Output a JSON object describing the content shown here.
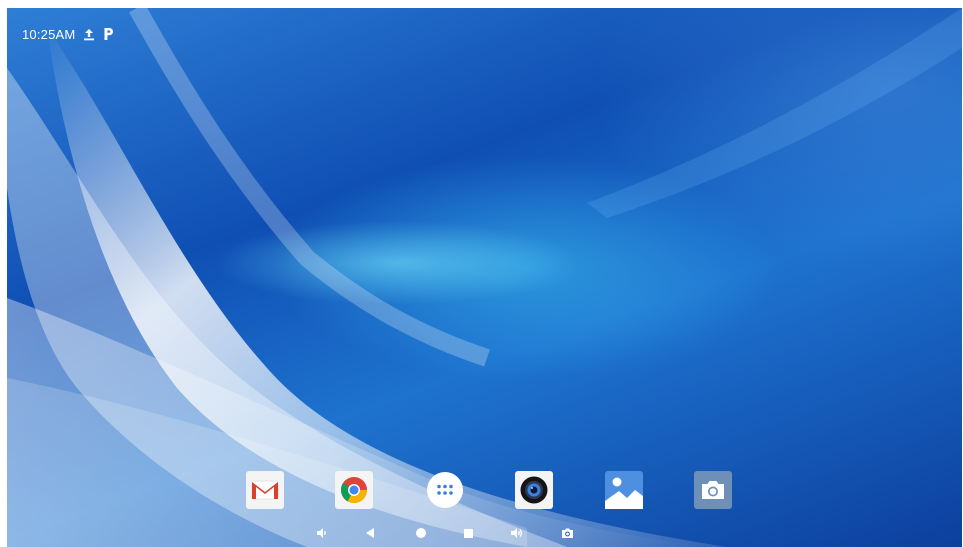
{
  "status_bar": {
    "time": "10:25AM",
    "icons": [
      "upload-icon",
      "parking-p-icon"
    ]
  },
  "dock": {
    "apps": [
      {
        "icon": "gmail-icon"
      },
      {
        "icon": "chrome-icon"
      },
      {
        "icon": "app-drawer-icon"
      },
      {
        "icon": "camera-lens-app-icon"
      },
      {
        "icon": "gallery-icon"
      },
      {
        "icon": "camera-icon"
      }
    ]
  },
  "nav_bar": {
    "buttons": [
      {
        "icon": "volume-down-icon"
      },
      {
        "icon": "back-icon"
      },
      {
        "icon": "home-icon"
      },
      {
        "icon": "recents-icon"
      },
      {
        "icon": "volume-up-icon"
      },
      {
        "icon": "screenshot-icon"
      }
    ]
  },
  "colors": {
    "wallpaper_deep_blue": "#0f4fb4",
    "wallpaper_cyan": "#3cbef0",
    "icon_white": "#ffffff",
    "gallery_tile": "#4f8fe0",
    "camera_tile": "#6e8fb8"
  }
}
